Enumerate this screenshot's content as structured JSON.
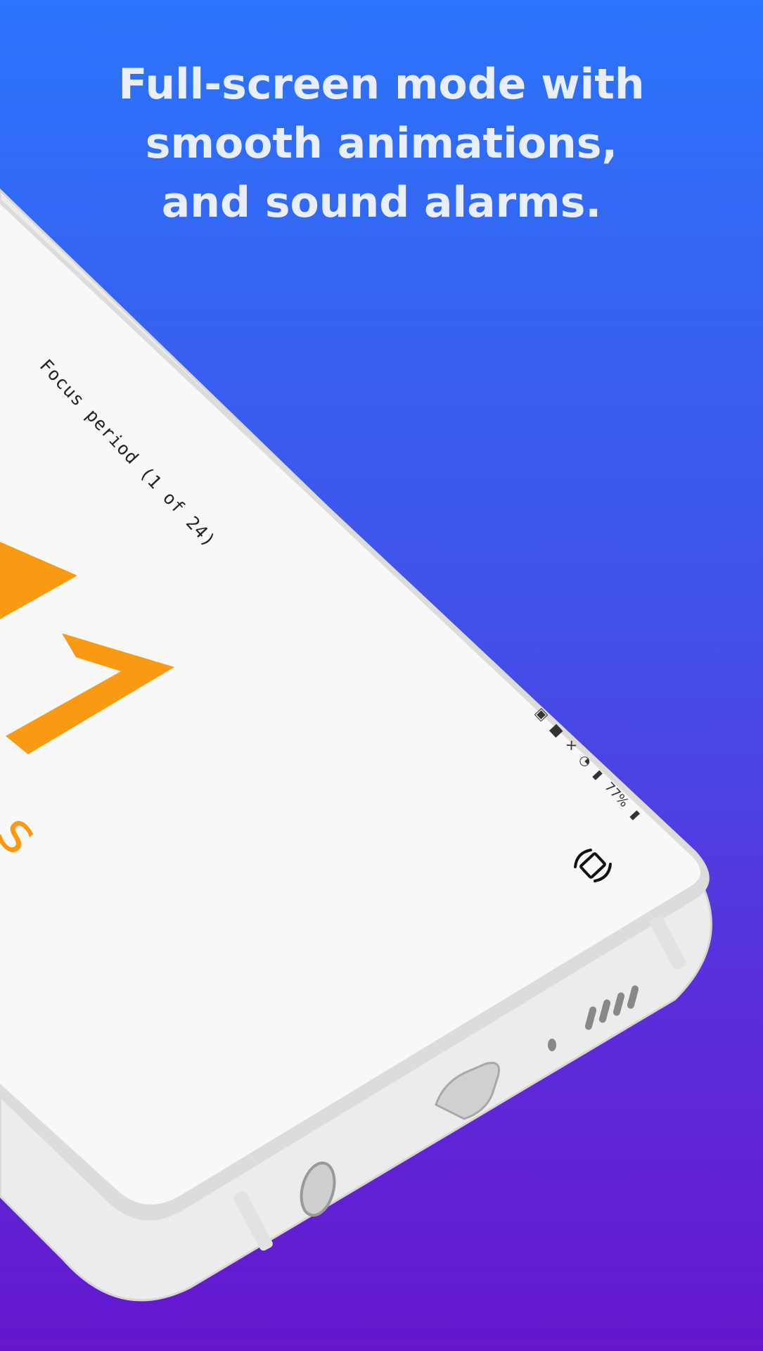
{
  "headline": {
    "line1": "Full-screen mode with",
    "line2": "smooth animations,",
    "line3": "and sound alarms."
  },
  "timer": {
    "period_label": "Focus period (1 of 24)",
    "unit": "s",
    "digit_color": "#fa9a12"
  },
  "status_bar": {
    "icons": [
      "photo-icon",
      "chat-icon",
      "mute-icon",
      "wifi-icon",
      "signal-icon"
    ],
    "battery_text": "77%"
  },
  "colors": {
    "gradient_top": "#2b74fb",
    "gradient_bottom": "#6517cc",
    "screen": "#f8f8f8",
    "phone_body": "#f1f1f1"
  }
}
